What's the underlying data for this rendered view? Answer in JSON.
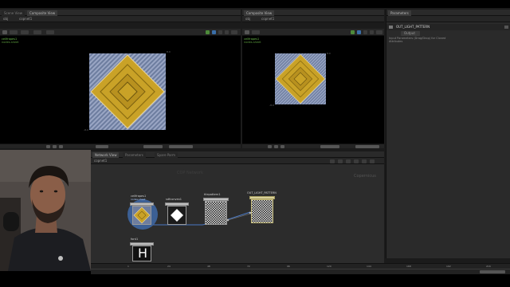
{
  "window": {
    "title": "Houdini"
  },
  "left_pane": {
    "tabs": [
      {
        "label": "Scene View"
      },
      {
        "label": "Composite View"
      }
    ],
    "node_path": "obj",
    "node_path2": "copnet1",
    "label": "cellfrapes1",
    "sublabel": "nodes-sheet",
    "coord_tr": "8.0",
    "coord_bl": "-8.0"
  },
  "mid_pane": {
    "tabs": [
      {
        "label": "Composite View"
      }
    ],
    "node_path": "obj",
    "node_path2": "copnet1",
    "label": "cellfrapes1",
    "sublabel": "nodes-sheet",
    "coord_tr": "8.0",
    "coord_bl": "-8.0"
  },
  "right_panel": {
    "tabs": [
      {
        "label": "Parameters"
      }
    ],
    "node_name": "OUT_LIGHT_PATTERN",
    "section": "Output",
    "info_line": "Input Parameters (Drag/Drop) for Cloned",
    "param_line": "Attributes"
  },
  "network": {
    "tabs": [
      {
        "label": "Network View"
      },
      {
        "label": "Parameters"
      },
      {
        "label": "Spare Parm"
      }
    ],
    "path": "copnet1",
    "context_label": "Copernicus",
    "top_label": "COP Network",
    "nodes": [
      {
        "name": "cellfrapes1",
        "sub": "nodes-sheet",
        "icon": "diamond-yellow"
      },
      {
        "name": "sdfconvex1",
        "sub": "",
        "icon": "diamond-white"
      },
      {
        "name": "tilepattern1",
        "sub": "",
        "icon": "checker"
      },
      {
        "name": "OUT_LIGHT_PATTERN",
        "sub": "",
        "icon": "checker"
      },
      {
        "name": "font1",
        "sub": "",
        "icon": "letter-h"
      }
    ],
    "font_glyph": "H",
    "timeline_ticks": [
      "1",
      "24",
      "48",
      "72",
      "96",
      "120",
      "144",
      "168",
      "192",
      "216",
      "240"
    ]
  },
  "colors": {
    "accent_blue": "#3a6ea8",
    "viewport_bg": "#000000",
    "gold": "#c9a227",
    "slate": "#6c7a9c",
    "node_selected": "#4a79c4"
  }
}
